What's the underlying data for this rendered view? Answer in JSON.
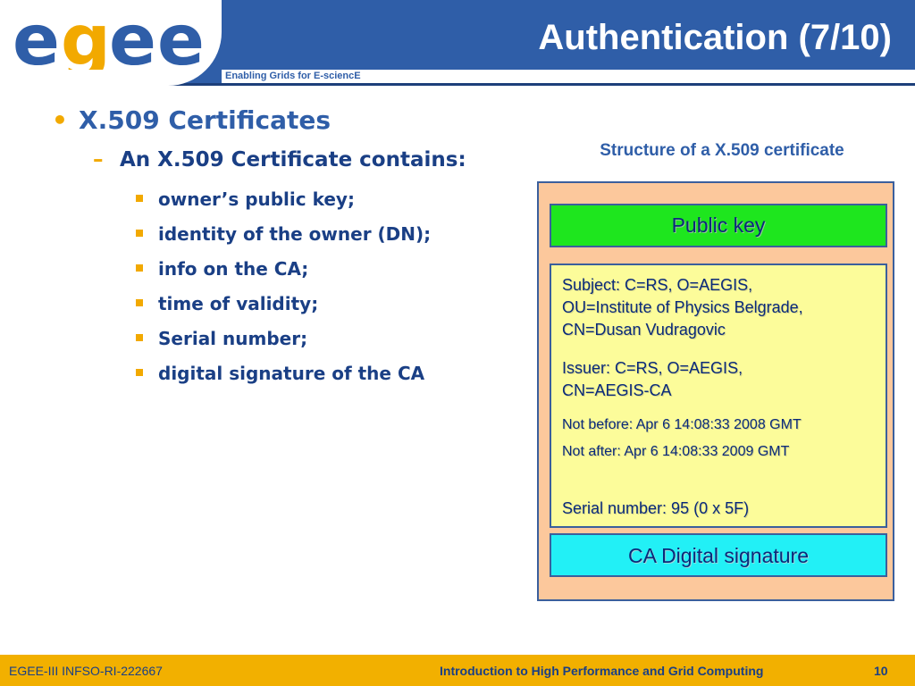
{
  "header": {
    "logo_text": "egee",
    "tagline": "Enabling Grids for E-sciencE",
    "title": "Authentication (7/10)"
  },
  "bullets": {
    "level1": "X.509 Certificates",
    "level2": "An X.509 Certificate contains:",
    "items": [
      "owner’s public key;",
      "identity of the owner (DN);",
      "info on the CA;",
      "time of validity;",
      "Serial number;",
      "digital signature of the CA"
    ]
  },
  "certificate": {
    "caption": "Structure of a X.509 certificate",
    "public_key": "Public key",
    "subject": [
      "Subject: C=RS, O=AEGIS,",
      "OU=Institute of Physics Belgrade,",
      "CN=Dusan Vudragovic"
    ],
    "issuer": [
      "Issuer: C=RS, O=AEGIS,",
      "CN=AEGIS-CA"
    ],
    "not_before": "Not before: Apr 6 14:08:33 2008 GMT",
    "not_after": "Not after: Apr 6 14:08:33 2009 GMT",
    "serial": "Serial number: 95 (0 x 5F)",
    "ca_signature": "CA Digital signature"
  },
  "footer": {
    "project": "EGEE-III INFSO-RI-222667",
    "course": "Introduction to High Performance and Grid Computing",
    "page_number": "10"
  },
  "colors": {
    "header_blue": "#2f5ea8",
    "accent_orange": "#f2b000",
    "public_key_green": "#1ee61e",
    "details_yellow": "#fcfc9a",
    "signature_cyan": "#22f0f6",
    "certificate_peach": "#fcc89c"
  }
}
